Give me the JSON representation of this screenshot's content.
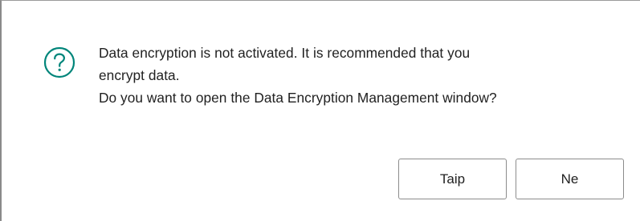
{
  "dialog": {
    "icon": "question-circle-icon",
    "accent_color": "#00857A",
    "message_lines": [
      "Data encryption is not activated. It is recommended that you",
      "encrypt data.",
      "Do you want to open the Data Encryption Management window?"
    ],
    "yes_label": "Taip",
    "no_label": "Ne"
  }
}
